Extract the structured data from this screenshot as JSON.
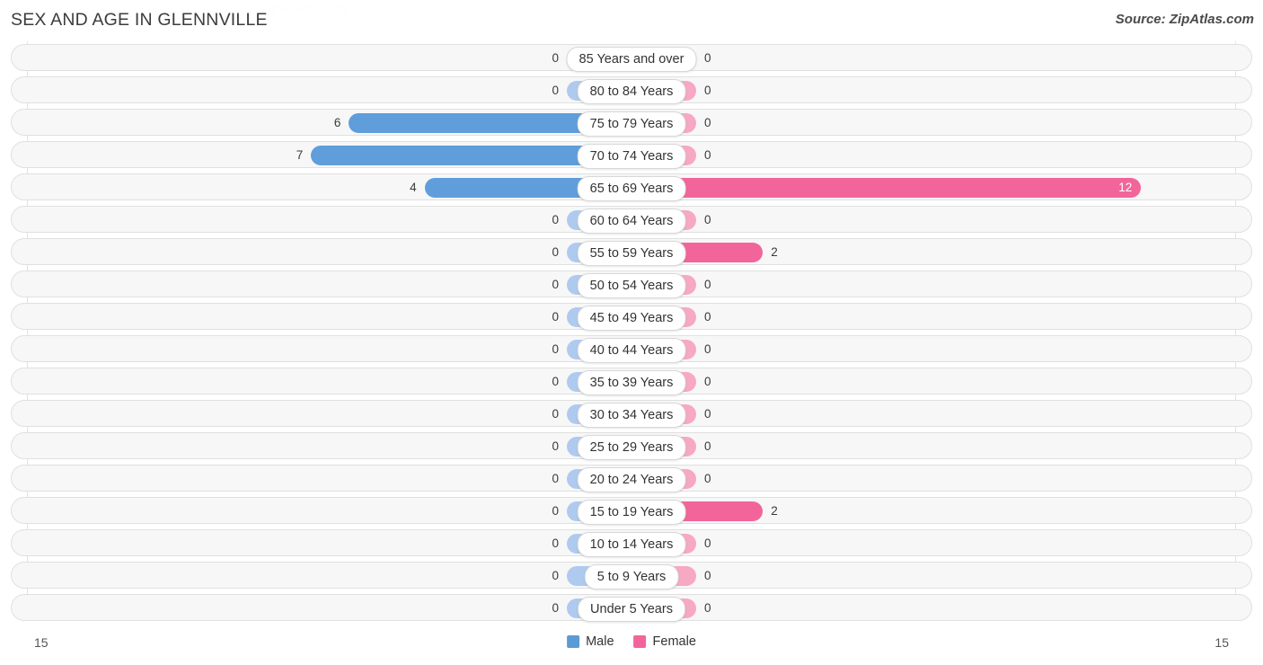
{
  "header": {
    "title": "SEX AND AGE IN GLENNVILLE",
    "source": "Source: ZipAtlas.com",
    "watermark": "ZipAtlas.com"
  },
  "legend": {
    "male_label": "Male",
    "female_label": "Female",
    "male_color": "#5B9BD5",
    "female_color": "#F2659A"
  },
  "axis": {
    "left_end": "15",
    "right_end": "15"
  },
  "colors": {
    "male_strong": "#5F9EDB",
    "male_light": "#AECBEF",
    "female_strong": "#F2659A",
    "female_light": "#F7A8C4",
    "row_bg": "#f7f7f7",
    "row_border": "#e0e0e0",
    "gridline": "#e3e3e3"
  },
  "chart_data": {
    "type": "bar",
    "title": "SEX AND AGE IN GLENNVILLE",
    "subtitle": "",
    "xlabel": "",
    "ylabel": "",
    "orientation": "horizontal-diverging",
    "axis_max": 15,
    "xlim": [
      -15,
      15
    ],
    "grid": true,
    "legend_position": "bottom-center",
    "categories": [
      "85 Years and over",
      "80 to 84 Years",
      "75 to 79 Years",
      "70 to 74 Years",
      "65 to 69 Years",
      "60 to 64 Years",
      "55 to 59 Years",
      "50 to 54 Years",
      "45 to 49 Years",
      "40 to 44 Years",
      "35 to 39 Years",
      "30 to 34 Years",
      "25 to 29 Years",
      "20 to 24 Years",
      "15 to 19 Years",
      "10 to 14 Years",
      "5 to 9 Years",
      "Under 5 Years"
    ],
    "series": [
      {
        "name": "Male",
        "color": "#5B9BD5",
        "values": [
          0,
          0,
          6,
          7,
          4,
          0,
          0,
          0,
          0,
          0,
          0,
          0,
          0,
          0,
          0,
          0,
          0,
          0
        ]
      },
      {
        "name": "Female",
        "color": "#F2659A",
        "values": [
          0,
          0,
          0,
          0,
          12,
          0,
          2,
          0,
          0,
          0,
          0,
          0,
          0,
          0,
          2,
          0,
          0,
          0
        ]
      }
    ]
  },
  "rows": [
    {
      "age": "85 Years and over",
      "male": "0",
      "female": "0"
    },
    {
      "age": "80 to 84 Years",
      "male": "0",
      "female": "0"
    },
    {
      "age": "75 to 79 Years",
      "male": "6",
      "female": "0"
    },
    {
      "age": "70 to 74 Years",
      "male": "7",
      "female": "0"
    },
    {
      "age": "65 to 69 Years",
      "male": "4",
      "female": "12"
    },
    {
      "age": "60 to 64 Years",
      "male": "0",
      "female": "0"
    },
    {
      "age": "55 to 59 Years",
      "male": "0",
      "female": "2"
    },
    {
      "age": "50 to 54 Years",
      "male": "0",
      "female": "0"
    },
    {
      "age": "45 to 49 Years",
      "male": "0",
      "female": "0"
    },
    {
      "age": "40 to 44 Years",
      "male": "0",
      "female": "0"
    },
    {
      "age": "35 to 39 Years",
      "male": "0",
      "female": "0"
    },
    {
      "age": "30 to 34 Years",
      "male": "0",
      "female": "0"
    },
    {
      "age": "25 to 29 Years",
      "male": "0",
      "female": "0"
    },
    {
      "age": "20 to 24 Years",
      "male": "0",
      "female": "0"
    },
    {
      "age": "15 to 19 Years",
      "male": "0",
      "female": "2"
    },
    {
      "age": "10 to 14 Years",
      "male": "0",
      "female": "0"
    },
    {
      "age": "5 to 9 Years",
      "male": "0",
      "female": "0"
    },
    {
      "age": "Under 5 Years",
      "male": "0",
      "female": "0"
    }
  ]
}
